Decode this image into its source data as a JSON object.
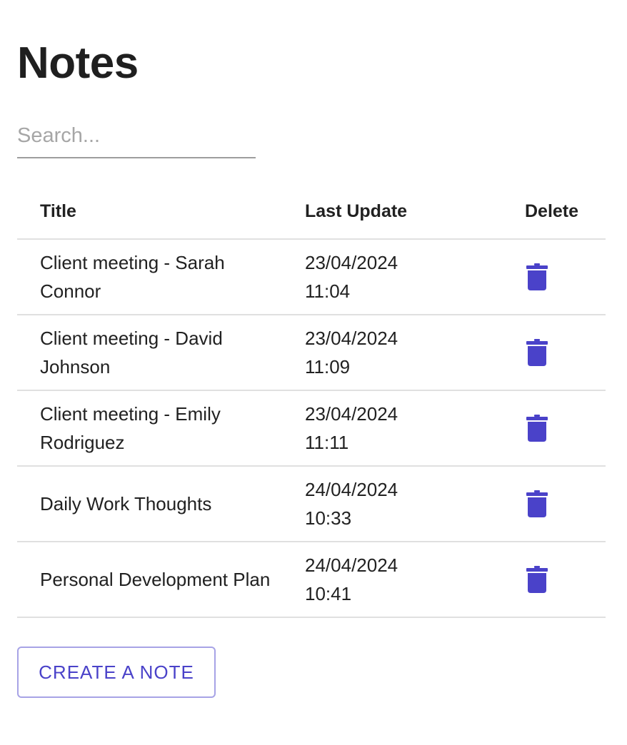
{
  "page": {
    "title": "Notes"
  },
  "search": {
    "placeholder": "Search...",
    "value": ""
  },
  "table": {
    "headers": {
      "title": "Title",
      "last_update": "Last Update",
      "delete": "Delete"
    },
    "rows": [
      {
        "title": "Client meeting - Sarah Connor",
        "date": "23/04/2024",
        "time": "11:04",
        "delete_icon": "trash-icon"
      },
      {
        "title": "Client meeting - David Johnson",
        "date": "23/04/2024",
        "time": "11:09",
        "delete_icon": "trash-icon"
      },
      {
        "title": "Client meeting - Emily Rodriguez",
        "date": "23/04/2024",
        "time": "11:11",
        "delete_icon": "trash-icon"
      },
      {
        "title": "Daily Work Thoughts",
        "date": "24/04/2024",
        "time": "10:33",
        "delete_icon": "trash-icon"
      },
      {
        "title": "Personal Development Plan",
        "date": "24/04/2024",
        "time": "10:41",
        "delete_icon": "trash-icon"
      }
    ]
  },
  "actions": {
    "create_label": "CREATE A NOTE"
  },
  "colors": {
    "accent": "#4a42c9",
    "text": "#212121",
    "divider": "#e0e0e0"
  }
}
